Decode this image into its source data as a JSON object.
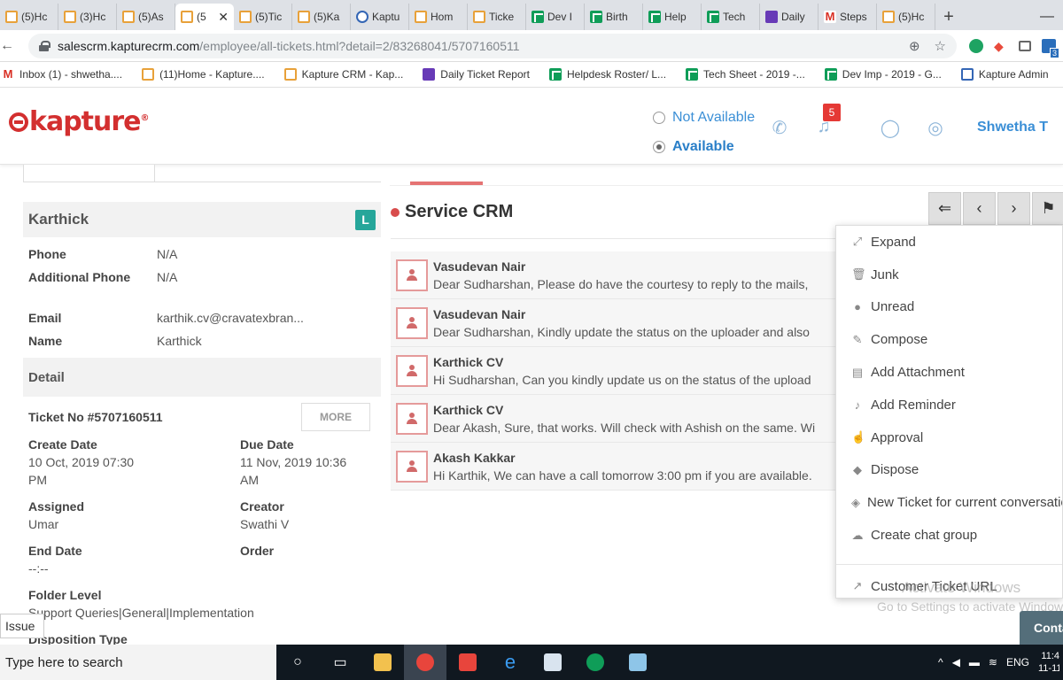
{
  "browser": {
    "tabs": [
      {
        "label": "(5)Hc",
        "icon": "kapture"
      },
      {
        "label": "(3)Hc",
        "icon": "kapture"
      },
      {
        "label": "(5)As",
        "icon": "kapture"
      },
      {
        "label": "(5",
        "icon": "kapture",
        "active": true
      },
      {
        "label": "(5)Tic",
        "icon": "kapture"
      },
      {
        "label": "(5)Ka",
        "icon": "kapture"
      },
      {
        "label": "Kaptu",
        "icon": "kapture-admin"
      },
      {
        "label": "Hom",
        "icon": "kapture"
      },
      {
        "label": "Ticke",
        "icon": "kapture"
      },
      {
        "label": "Dev I",
        "icon": "sheets"
      },
      {
        "label": "Birth",
        "icon": "sheets"
      },
      {
        "label": "Help",
        "icon": "sheets"
      },
      {
        "label": "Tech",
        "icon": "sheets"
      },
      {
        "label": "Daily",
        "icon": "forms"
      },
      {
        "label": "Steps",
        "icon": "gmail"
      },
      {
        "label": "(5)Hc",
        "icon": "kapture"
      }
    ],
    "tab_close": "✕",
    "new_tab": "+",
    "url_host": "salescrm.kapturecrm.com",
    "url_path": "/employee/all-tickets.html?detail=2/83268041/5707160511",
    "ext_badge": "3",
    "bookmarks": [
      {
        "label": "Inbox (1) - shwetha....",
        "icon": "gmail"
      },
      {
        "label": "(11)Home - Kapture....",
        "icon": "kapture"
      },
      {
        "label": "Kapture CRM - Kap...",
        "icon": "kapture"
      },
      {
        "label": "Daily Ticket Report",
        "icon": "forms"
      },
      {
        "label": "Helpdesk Roster/ L...",
        "icon": "sheets"
      },
      {
        "label": "Tech Sheet - 2019 -...",
        "icon": "sheets"
      },
      {
        "label": "Dev Imp - 2019 - G...",
        "icon": "sheets"
      },
      {
        "label": "Kapture Admin",
        "icon": "kapture-admin"
      }
    ]
  },
  "header": {
    "logo_text": "kapture",
    "status_options": [
      {
        "label": "Not Available",
        "selected": false
      },
      {
        "label": "Available",
        "selected": true
      }
    ],
    "notification_count": "5",
    "user_name": "Shwetha T"
  },
  "customer": {
    "name": "Karthick",
    "badge": "L",
    "fields": [
      {
        "key": "Phone",
        "value": "N/A"
      },
      {
        "key": "Additional Phone",
        "value": "N/A"
      },
      {
        "key": "Email",
        "value": "karthik.cv@cravatexbran..."
      },
      {
        "key": "Name",
        "value": "Karthick"
      }
    ]
  },
  "detail": {
    "heading": "Detail",
    "ticket_no": "Ticket No #5707160511",
    "more_label": "MORE",
    "create_date_label": "Create Date",
    "create_date": "10 Oct, 2019 07:30 PM",
    "due_date_label": "Due Date",
    "due_date": "11 Nov, 2019 10:36 AM",
    "assigned_label": "Assigned",
    "assigned": "Umar",
    "creator_label": "Creator",
    "creator": "Swathi V",
    "end_date_label": "End Date",
    "end_date": "--:--",
    "order_label": "Order",
    "order": "",
    "folder_level_label": "Folder Level",
    "folder_level": "Support Queries|General|Implementation",
    "disposition_label": "Disposition Type"
  },
  "issue_tag": "Issue",
  "conversation": {
    "title": "Service CRM",
    "items": [
      {
        "author": "Vasudevan Nair",
        "message": "Dear Sudharshan, Please do have the courtesy to reply to the mails,"
      },
      {
        "author": "Vasudevan Nair",
        "message": "Dear Sudharshan,  Kindly update the status on the uploader and also"
      },
      {
        "author": "Karthick CV",
        "message": "Hi Sudharshan, Can you kindly update us on the status of the upload"
      },
      {
        "author": "Karthick CV",
        "message": "Dear Akash, Sure, that works. Will check with Ashish on the same. Wi"
      },
      {
        "author": "Akash Kakkar",
        "message": "Hi Karthik, We can have a call tomorrow 3:00 pm if you are available."
      }
    ]
  },
  "menu": {
    "items": [
      {
        "label": "Expand",
        "icon": "expand-icon"
      },
      {
        "label": "Junk",
        "icon": "trash-icon"
      },
      {
        "label": "Unread",
        "icon": "circle-icon"
      },
      {
        "label": "Compose",
        "icon": "edit-icon"
      },
      {
        "label": "Add Attachment",
        "icon": "file-icon"
      },
      {
        "label": "Add Reminder",
        "icon": "bell-icon"
      },
      {
        "label": "Approval",
        "icon": "thumbs-up-icon"
      },
      {
        "label": "Dispose",
        "icon": "tags-icon"
      },
      {
        "label": "New Ticket for current conversation",
        "icon": "ticket-icon"
      },
      {
        "label": "Create chat group",
        "icon": "chat-icon"
      }
    ],
    "bottom_item": {
      "label": "Customer Ticket URL",
      "icon": "external-link-icon"
    }
  },
  "watermark": {
    "line1": "Activate Windows",
    "line2": "Go to Settings to activate Windows."
  },
  "contact_button": "Contact",
  "taskbar": {
    "search_placeholder": "Type here to search",
    "lang": "ENG",
    "time": "11:4",
    "date": "11-11-"
  }
}
